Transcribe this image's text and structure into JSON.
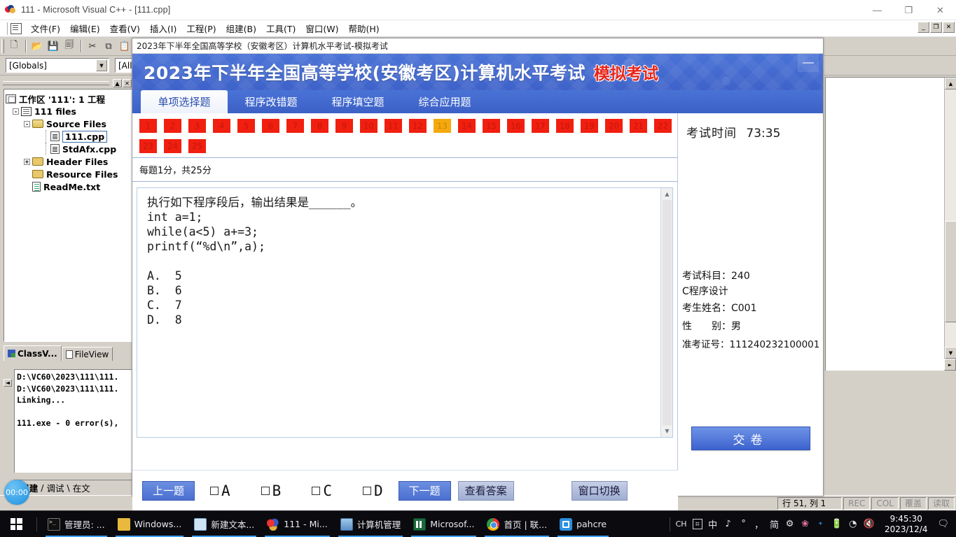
{
  "vc": {
    "title": "111 - Microsoft Visual C++ - [111.cpp]",
    "window_buttons": [
      "—",
      "❐",
      "✕"
    ],
    "mdi_buttons": [
      "_",
      "❐",
      "✕"
    ],
    "menus": [
      "文件(F)",
      "编辑(E)",
      "查看(V)",
      "插入(I)",
      "工程(P)",
      "组建(B)",
      "工具(T)",
      "窗口(W)",
      "帮助(H)"
    ],
    "toolbar_icons": [
      "new-file-icon",
      "open-folder-icon",
      "save-icon",
      "save-all-icon",
      "cut-icon",
      "copy-icon",
      "paste-icon"
    ],
    "combo_globals": "[Globals]",
    "combo_all": "[All",
    "tree": [
      {
        "label": "工作区 '111': 1 工程",
        "level": 0,
        "icon": "workspace-icon",
        "expander": "",
        "bold": true
      },
      {
        "label": "111 files",
        "level": 1,
        "icon": "project-icon",
        "expander": "-",
        "bold": true
      },
      {
        "label": "Source Files",
        "level": 2,
        "icon": "folder-open-icon",
        "expander": "-",
        "bold": true
      },
      {
        "label": "111.cpp",
        "level": 3,
        "icon": "cpp-file-icon",
        "expander": "",
        "bold": true,
        "selected": true
      },
      {
        "label": "StdAfx.cpp",
        "level": 3,
        "icon": "cpp-file-icon",
        "expander": "",
        "bold": true
      },
      {
        "label": "Header Files",
        "level": 2,
        "icon": "folder-icon",
        "expander": "+",
        "bold": true
      },
      {
        "label": "Resource Files",
        "level": 2,
        "icon": "folder-icon",
        "expander": "",
        "bold": true
      },
      {
        "label": "ReadMe.txt",
        "level": 2,
        "icon": "text-file-icon",
        "expander": "",
        "bold": true
      }
    ],
    "ws_tabs": [
      {
        "label": "ClassV...",
        "active": true
      },
      {
        "label": "FileView",
        "active": false
      }
    ],
    "output_text": "D:\\VC60\\2023\\111\\111.\nD:\\VC60\\2023\\111\\111.\nLinking...\n\n111.exe - 0 error(s),",
    "output_tabs": [
      {
        "label": "组建",
        "active": true
      },
      {
        "label": "调试",
        "active": false
      },
      {
        "label": "在文",
        "active": false
      }
    ],
    "timer_badge": "00:00",
    "status": {
      "position": "行 51, 列 1",
      "rec": "REC",
      "col": "COL",
      "ovr": "覆盖",
      "read": "读取"
    }
  },
  "exam": {
    "caption": "2023年下半年全国高等学校（安徽考区）计算机水平考试-模拟考试",
    "title_main": "2023年下半年全国高等学校(安徽考区)计算机水平考试",
    "title_red": "模拟考试",
    "minimize_label": "—",
    "tabs": [
      {
        "label": "单项选择题",
        "active": true
      },
      {
        "label": "程序改错题",
        "active": false
      },
      {
        "label": "程序填空题",
        "active": false
      },
      {
        "label": "综合应用题",
        "active": false
      }
    ],
    "question_numbers": [
      "1",
      "2",
      "3",
      "4",
      "5",
      "6",
      "7",
      "8",
      "9",
      "10",
      "11",
      "12",
      "13",
      "14",
      "15",
      "16",
      "17",
      "18",
      "19",
      "20",
      "21",
      "22",
      "23",
      "24",
      "25"
    ],
    "current_question": "13",
    "score_note": "每题1分，共25分",
    "question_text": "执行如下程序段后，输出结果是______。\nint a=1;\nwhile(a<5) a+=3;\nprintf(“%d\\n”,a);\n\nA.  5\nB.  6\nC.  7\nD.  8",
    "footer": {
      "prev": "上一题",
      "options": [
        "A",
        "B",
        "C",
        "D"
      ],
      "next": "下一题",
      "view_answer": "查看答案",
      "window_switch": "窗口切换"
    },
    "info": {
      "time_label": "考试时间",
      "time_value": "73:35",
      "subject_label": "考试科目：",
      "subject_code": "240",
      "subject_name": "C程序设计",
      "name_label": "考生姓名：",
      "name_value": "C001",
      "gender_label": "性　　别：",
      "gender_value": "男",
      "ticket_label": "准考证号：",
      "ticket_value": "111240232100001"
    },
    "submit_label": "交卷",
    "colors": {
      "header_blue": "#4a73d6",
      "qnum_red": "#f01f10",
      "qnum_current": "#f5a90f",
      "title_red": "#e8251b"
    }
  },
  "taskbar": {
    "start_label": "start-button",
    "items": [
      {
        "label": "管理员: ...",
        "icon": "cmd-icon",
        "running": true
      },
      {
        "label": "Windows...",
        "icon": "folder-icon",
        "running": true
      },
      {
        "label": "新建文本...",
        "icon": "notepad-icon",
        "running": true
      },
      {
        "label": "111 - Mi...",
        "icon": "visual-cpp-icon",
        "running": true
      },
      {
        "label": "计算机管理",
        "icon": "computer-management-icon",
        "running": true
      },
      {
        "label": "Microsof...",
        "icon": "excel-icon",
        "running": true
      },
      {
        "label": "首页 | 联...",
        "icon": "chrome-icon",
        "running": true
      },
      {
        "label": "pahcre",
        "icon": "pahcre-icon",
        "running": true
      }
    ],
    "tray": [
      "CH",
      "⌗",
      "中",
      "♪",
      "°",
      "，",
      "简",
      "⚙"
    ],
    "tray_icons": [
      "sakura-icon",
      "bluetooth-icon",
      "battery-icon",
      "wifi-icon",
      "volume-mute-icon"
    ],
    "clock_time": "9:45:30",
    "clock_date": "2023/12/4",
    "notification_icon": "notification-icon"
  }
}
